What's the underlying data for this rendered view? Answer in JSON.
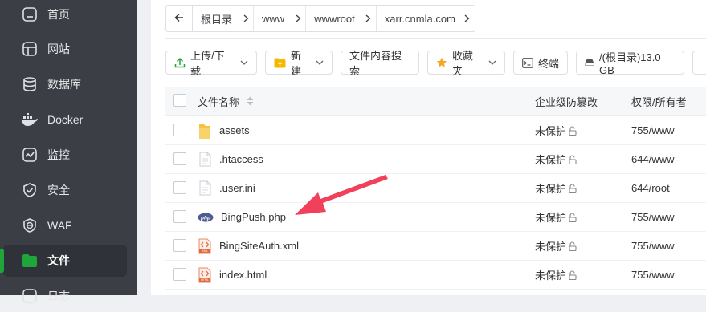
{
  "sidebar": {
    "items": [
      {
        "label": "首页",
        "icon": "home-icon"
      },
      {
        "label": "网站",
        "icon": "globe-icon"
      },
      {
        "label": "数据库",
        "icon": "database-icon"
      },
      {
        "label": "Docker",
        "icon": "docker-icon"
      },
      {
        "label": "监控",
        "icon": "monitor-icon"
      },
      {
        "label": "安全",
        "icon": "shield-icon"
      },
      {
        "label": "WAF",
        "icon": "waf-icon"
      },
      {
        "label": "文件",
        "icon": "folder-icon",
        "active": true
      },
      {
        "label": "日志",
        "icon": "log-icon"
      }
    ],
    "accent": "#20a53a"
  },
  "breadcrumb": {
    "back_icon": "arrow-left-icon",
    "items": [
      "根目录",
      "www",
      "wwwroot",
      "xarr.cnmla.com"
    ]
  },
  "toolbar": {
    "upload_label": "上传/下载",
    "new_label": "新建",
    "search_content_label": "文件内容搜索",
    "favorites_label": "收藏夹",
    "terminal_label": "终端",
    "disk_label": "/(根目录)13.0 GB"
  },
  "table": {
    "headers": {
      "name": "文件名称",
      "protection": "企业级防篡改",
      "permission": "权限/所有者"
    },
    "rows": [
      {
        "name": "assets",
        "type": "folder",
        "protection": "未保护",
        "permission": "755/www"
      },
      {
        "name": ".htaccess",
        "type": "file",
        "protection": "未保护",
        "permission": "644/www"
      },
      {
        "name": ".user.ini",
        "type": "file",
        "protection": "未保护",
        "permission": "644/root"
      },
      {
        "name": "BingPush.php",
        "type": "php",
        "protection": "未保护",
        "permission": "755/www"
      },
      {
        "name": "BingSiteAuth.xml",
        "type": "xml",
        "protection": "未保护",
        "permission": "755/www"
      },
      {
        "name": "index.html",
        "type": "html",
        "protection": "未保护",
        "permission": "755/www"
      }
    ]
  },
  "annotation_color": "#f0405a"
}
